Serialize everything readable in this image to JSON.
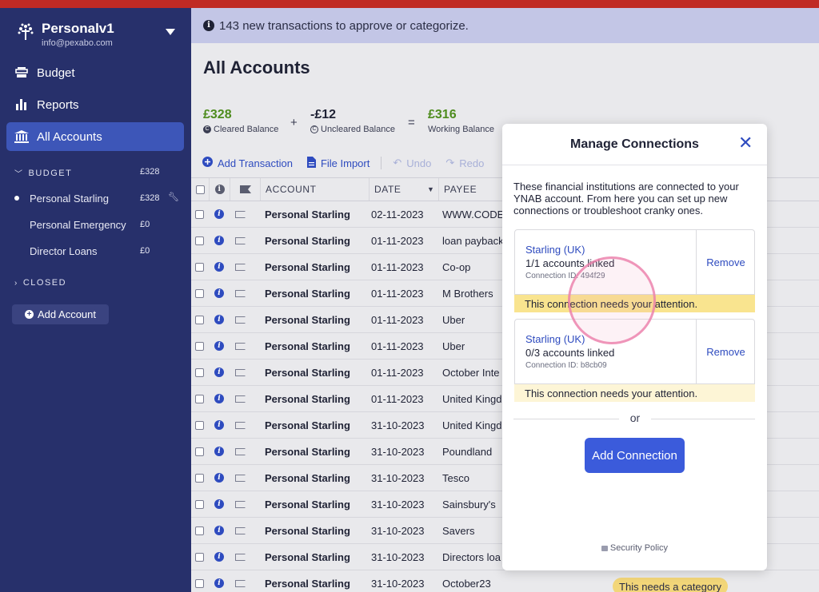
{
  "budget": {
    "name": "Personalv1",
    "email": "info@pexabo.com"
  },
  "nav": [
    {
      "label": "Budget",
      "icon": "budget-icon"
    },
    {
      "label": "Reports",
      "icon": "reports-icon"
    },
    {
      "label": "All Accounts",
      "icon": "bank-icon"
    }
  ],
  "sidebar": {
    "budget_section": {
      "label": "BUDGET",
      "amount": "£328"
    },
    "accounts": [
      {
        "name": "Personal Starling",
        "amount": "£328"
      },
      {
        "name": "Personal Emergency",
        "amount": "£0"
      },
      {
        "name": "Director Loans",
        "amount": "£0"
      }
    ],
    "closed_label": "CLOSED",
    "add_account": "Add Account"
  },
  "banner": {
    "text": "143 new transactions to approve or categorize."
  },
  "page_title": "All Accounts",
  "balances": {
    "cleared": {
      "value": "£328",
      "label": "Cleared Balance"
    },
    "plus": "+",
    "uncleared": {
      "value": "-£12",
      "label": "Uncleared Balance"
    },
    "equals": "=",
    "working": {
      "value": "£316",
      "label": "Working Balance"
    }
  },
  "toolbar": {
    "add_transaction": "Add Transaction",
    "file_import": "File Import",
    "undo": "Undo",
    "redo": "Redo"
  },
  "table": {
    "headers": {
      "account": "ACCOUNT",
      "date": "DATE",
      "payee": "PAYEE"
    },
    "rows": [
      {
        "account": "Personal Starling",
        "date": "02-11-2023",
        "payee": "WWW.CODE"
      },
      {
        "account": "Personal Starling",
        "date": "01-11-2023",
        "payee": "loan payback"
      },
      {
        "account": "Personal Starling",
        "date": "01-11-2023",
        "payee": "Co-op"
      },
      {
        "account": "Personal Starling",
        "date": "01-11-2023",
        "payee": "M Brothers"
      },
      {
        "account": "Personal Starling",
        "date": "01-11-2023",
        "payee": "Uber"
      },
      {
        "account": "Personal Starling",
        "date": "01-11-2023",
        "payee": "Uber"
      },
      {
        "account": "Personal Starling",
        "date": "01-11-2023",
        "payee": "October Inte"
      },
      {
        "account": "Personal Starling",
        "date": "01-11-2023",
        "payee": "United Kingd"
      },
      {
        "account": "Personal Starling",
        "date": "31-10-2023",
        "payee": "United Kingd"
      },
      {
        "account": "Personal Starling",
        "date": "31-10-2023",
        "payee": "Poundland"
      },
      {
        "account": "Personal Starling",
        "date": "31-10-2023",
        "payee": "Tesco"
      },
      {
        "account": "Personal Starling",
        "date": "31-10-2023",
        "payee": "Sainsbury's"
      },
      {
        "account": "Personal Starling",
        "date": "31-10-2023",
        "payee": "Savers"
      },
      {
        "account": "Personal Starling",
        "date": "31-10-2023",
        "payee": "Directors loa"
      },
      {
        "account": "Personal Starling",
        "date": "31-10-2023",
        "payee": "October23"
      }
    ],
    "category_badge": "This needs a category"
  },
  "modal": {
    "title": "Manage Connections",
    "description": "These financial institutions are connected to your YNAB account. From here you can set up new connections or troubleshoot cranky ones.",
    "connections": [
      {
        "name": "Starling (UK)",
        "accounts": "1/1 accounts linked",
        "connection_id": "Connection ID: 494f29",
        "remove": "Remove",
        "warning": "This connection needs your attention."
      },
      {
        "name": "Starling (UK)",
        "accounts": "0/3 accounts linked",
        "connection_id": "Connection ID: b8cb09",
        "remove": "Remove",
        "warning": "This connection needs your attention."
      }
    ],
    "or": "or",
    "add_connection": "Add Connection",
    "security_policy": "Security Policy"
  },
  "colors": {
    "sidebar": "#27306b",
    "accent": "#3b5bdb",
    "positive": "#4e8c1e",
    "warning": "#f9e48f",
    "banner": "#c3c6e6"
  }
}
